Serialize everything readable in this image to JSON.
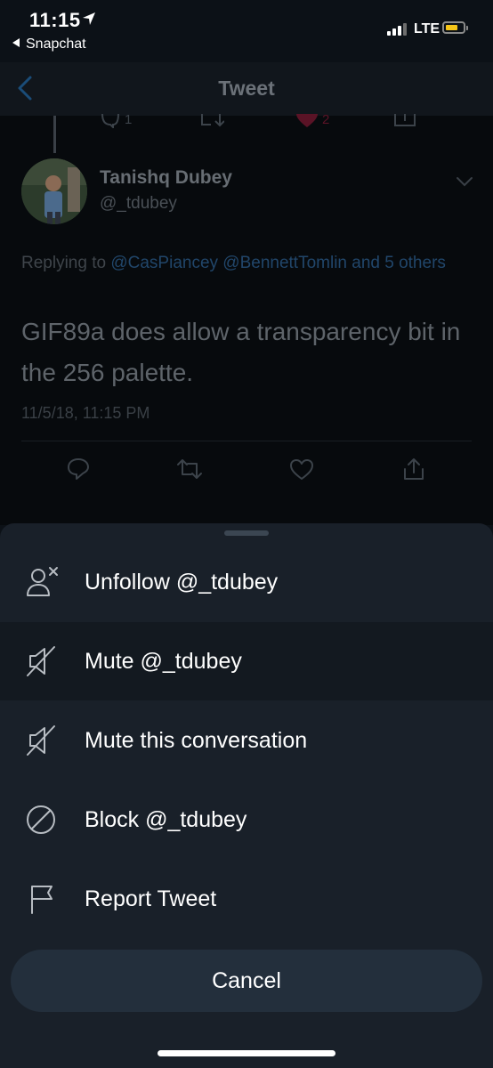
{
  "status_bar": {
    "time": "11:15",
    "back_app": "Snapchat",
    "network": "LTE"
  },
  "header": {
    "title": "Tweet"
  },
  "previous_tweet_actions": {
    "reply_count": "1",
    "like_count": "2"
  },
  "tweet": {
    "author_name": "Tanishq Dubey",
    "author_handle": "@_tdubey",
    "replying_prefix": "Replying to ",
    "replying_mentions": "@CasPiancey @BennettTomlin and 5 others",
    "text": "GIF89a does allow a transparency bit in the 256 palette.",
    "timestamp": "11/5/18, 11:15 PM"
  },
  "sheet": {
    "items": [
      {
        "label": "Unfollow @_tdubey",
        "icon": "unfollow-icon"
      },
      {
        "label": "Mute @_tdubey",
        "icon": "mute-icon"
      },
      {
        "label": "Mute this conversation",
        "icon": "mute-conversation-icon"
      },
      {
        "label": "Block @_tdubey",
        "icon": "block-icon"
      },
      {
        "label": "Report Tweet",
        "icon": "flag-icon"
      }
    ],
    "cancel_label": "Cancel"
  },
  "colors": {
    "sheet_background": "#192029",
    "accent_blue": "#1da1f2",
    "like_red": "#e0245e"
  }
}
